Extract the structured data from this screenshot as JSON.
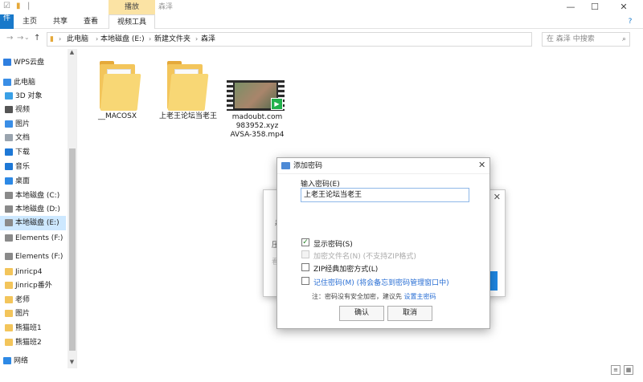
{
  "title_bar": {
    "tool_tab": "播放",
    "window_title": "森泽",
    "minimize": "—",
    "maximize": "☐",
    "close": "✕"
  },
  "ribbon": {
    "file_tab": "件",
    "tabs": [
      "主页",
      "共享",
      "查看",
      "视频工具"
    ],
    "help_icon": "?"
  },
  "address": {
    "back": "→",
    "forward": "→",
    "up": "↑",
    "breadcrumb": [
      "此电脑",
      "本地磁盘 (E:)",
      "新建文件夹",
      "森泽"
    ],
    "search_placeholder": "在 森泽 中搜索"
  },
  "sidebar": {
    "items": [
      {
        "label": "WPS云盘",
        "icon": "cloud-icon",
        "color": "#2f7fe0"
      },
      {
        "label": "此电脑",
        "icon": "computer-icon",
        "color": "#3a8ee6"
      },
      {
        "label": "3D 对象",
        "icon": "cube-icon",
        "color": "#3aa0e6"
      },
      {
        "label": "视频",
        "icon": "film-icon",
        "color": "#555555"
      },
      {
        "label": "图片",
        "icon": "picture-icon",
        "color": "#3a8ee6"
      },
      {
        "label": "文档",
        "icon": "document-icon",
        "color": "#9aa4ae"
      },
      {
        "label": "下载",
        "icon": "download-icon",
        "color": "#1e78d6"
      },
      {
        "label": "音乐",
        "icon": "music-icon",
        "color": "#1e78d6"
      },
      {
        "label": "桌面",
        "icon": "desktop-icon",
        "color": "#2d89e5"
      },
      {
        "label": "本地磁盘 (C:)",
        "icon": "drive-icon",
        "color": "#8a8a8a"
      },
      {
        "label": "本地磁盘 (D:)",
        "icon": "drive-icon",
        "color": "#8a8a8a"
      },
      {
        "label": "本地磁盘 (E:)",
        "icon": "drive-icon",
        "color": "#8a8a8a",
        "selected": true
      },
      {
        "label": "Elements (F:)",
        "icon": "drive-icon",
        "color": "#8a8a8a"
      },
      {
        "label": "Elements (F:)",
        "icon": "drive-icon",
        "color": "#8a8a8a"
      },
      {
        "label": "Jinricp4",
        "icon": "folder-icon",
        "color": "#f3c55b"
      },
      {
        "label": "Jinricp番外",
        "icon": "folder-icon",
        "color": "#f3c55b"
      },
      {
        "label": "老师",
        "icon": "folder-icon",
        "color": "#f3c55b"
      },
      {
        "label": "图片",
        "icon": "folder-icon",
        "color": "#f3c55b"
      },
      {
        "label": "熊猫班1",
        "icon": "folder-icon",
        "color": "#f3c55b"
      },
      {
        "label": "熊猫班2",
        "icon": "folder-icon",
        "color": "#f3c55b"
      },
      {
        "label": "网络",
        "icon": "network-icon",
        "color": "#2d89e5"
      }
    ]
  },
  "files": [
    {
      "name": "__MACOSX",
      "type": "folder"
    },
    {
      "name": "上老王论坛当老王",
      "type": "folder"
    },
    {
      "name": "madoubt.com 983952.xyz AVSA-358.mp4",
      "type": "video"
    }
  ],
  "background_dialog": {
    "fragment_1": "森",
    "fragment_2": "压",
    "fragment_3": "看"
  },
  "dialog": {
    "title": "添加密码",
    "password_label": "输入密码(E)",
    "password_value": "上老王论坛当老王",
    "show_password": "显示密码(S)",
    "encrypt_filenames": "加密文件名(N) (不支持ZIP格式)",
    "zip_classic": "ZIP经典加密方式(L)",
    "remember_password": "记住密码(M) (将会备忘到密码管理窗口中)",
    "note_prefix": "注：密码没有安全加密，建议先",
    "note_link": "设置主密码",
    "ok": "确认",
    "cancel": "取消",
    "close": "✕",
    "show_password_checked": true
  },
  "status": {
    "details_view": "≡",
    "icon_view": "▦"
  }
}
